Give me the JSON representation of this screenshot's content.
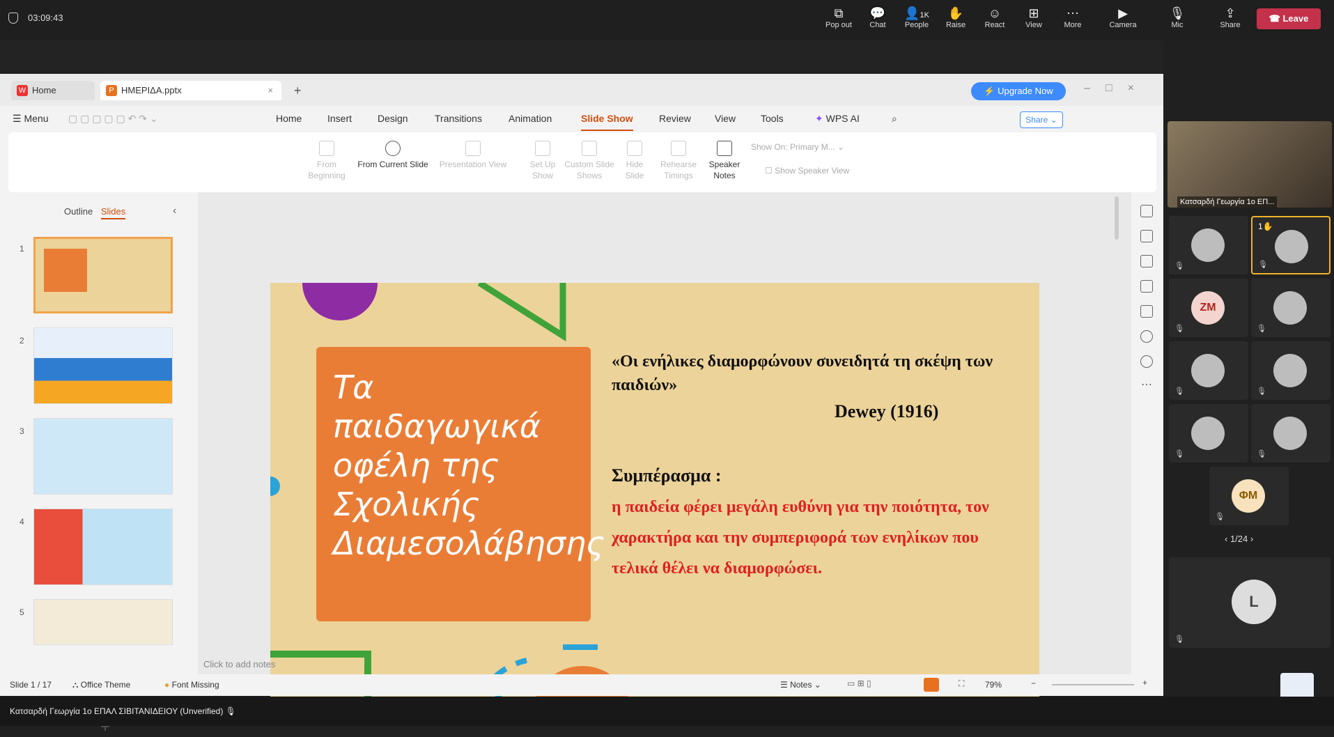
{
  "meeting": {
    "time": "03:09:43",
    "toolbar": [
      {
        "label": "Pop out",
        "icon": "pop-out-icon"
      },
      {
        "label": "Chat",
        "icon": "chat-icon"
      },
      {
        "label": "People",
        "icon": "people-icon",
        "count": "1K"
      },
      {
        "label": "Raise",
        "icon": "raise-hand-icon"
      },
      {
        "label": "React",
        "icon": "react-icon"
      },
      {
        "label": "View",
        "icon": "view-icon"
      },
      {
        "label": "More",
        "icon": "more-icon"
      },
      {
        "label": "Camera",
        "icon": "camera-off-icon"
      },
      {
        "label": "Mic",
        "icon": "mic-off-icon"
      },
      {
        "label": "Share",
        "icon": "share-icon"
      }
    ],
    "leave_label": "Leave",
    "presenter": "Κατσαρδή Γεωργία 1ο ΕΠΑΛ ΣΙΒΙΤΑΝΙΔΕΙΟΥ (Unverified)",
    "video_name": "Κατσαρδή Γεωργία 1ο ΕΠ...",
    "raise_count": "1",
    "initials": [
      "ZM",
      "ΦΜ",
      "L"
    ],
    "pager": "1/24"
  },
  "wps": {
    "tabs": {
      "home": "Home",
      "file": "ΗΜΕΡΙΔΑ.pptx"
    },
    "upgrade": "Upgrade Now",
    "menu": {
      "menu": "Menu",
      "items": [
        "Home",
        "Insert",
        "Design",
        "Transitions",
        "Animation",
        "Slide Show",
        "Review",
        "View",
        "Tools",
        "WPS AI"
      ]
    },
    "share": "Share",
    "ribbon": {
      "from_beginning": "From Beginning",
      "from_current": "From Current Slide",
      "presentation_view": "Presentation View",
      "setup_show": "Set Up Show",
      "custom_shows": "Custom Slide Shows",
      "hide_slide": "Hide Slide",
      "rehearse": "Rehearse Timings",
      "speaker_notes": "Speaker Notes",
      "show_on": "Show On",
      "show_on_value": "Primary M...",
      "speaker_view": "Show Speaker View"
    },
    "pane": {
      "outline": "Outline",
      "slides": "Slides"
    },
    "slide_numbers": [
      "1",
      "2",
      "3",
      "4",
      "5"
    ],
    "notes_placeholder": "Click to add notes",
    "status": {
      "slide": "Slide 1 / 17",
      "theme": "Office Theme",
      "font": "Font Missing",
      "notes": "Notes",
      "zoom": "79%"
    }
  },
  "slide": {
    "title": "Τα παιδαγωγικά οφέλη της Σχολικής Διαμεσολάβησης",
    "quote": "«Οι ενήλικες διαμορφώνουν συνειδητά τη σκέψη των παιδιών»",
    "author": "Dewey (1916)",
    "conclusion_heading": "Συμπέρασμα :",
    "conclusion": "η παιδεία φέρει μεγάλη ευθύνη για την ποιότητα, τον χαρακτήρα και την συμπεριφορά των ενηλίκων που τελικά θέλει να διαμορφώσει.",
    "colors": {
      "bg": "#ecd39a",
      "orange": "#ea7d36",
      "green": "#3fa33a",
      "purple": "#8e2ca4",
      "blue": "#2aa3d8",
      "red": "#e02020"
    }
  }
}
